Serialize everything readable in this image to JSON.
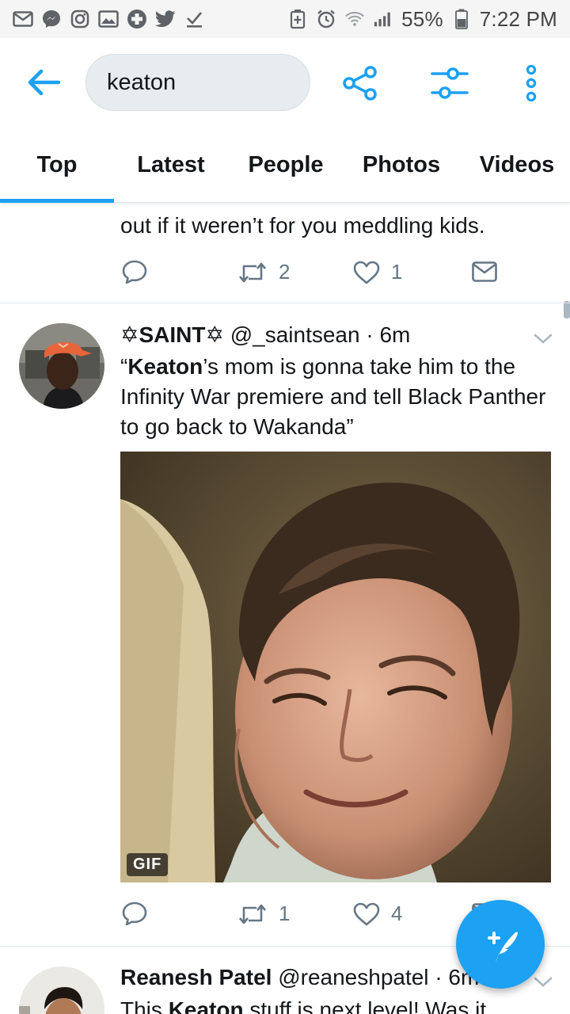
{
  "status_bar": {
    "left_icons": [
      "mail-icon",
      "messenger-icon",
      "instagram-icon",
      "gallery-icon",
      "medical-cross-icon",
      "twitter-bird-icon",
      "download-done-icon"
    ],
    "battery_percent": "55%",
    "time": "7:22 PM"
  },
  "search": {
    "query": "keaton"
  },
  "tabs": [
    {
      "label": "Top",
      "active": true
    },
    {
      "label": "Latest",
      "active": false
    },
    {
      "label": "People",
      "active": false
    },
    {
      "label": "Photos",
      "active": false
    },
    {
      "label": "Videos",
      "active": false
    }
  ],
  "tweets": [
    {
      "text_partial": "out if it weren’t for you meddling kids.",
      "retweets": "2",
      "likes": "1"
    },
    {
      "display_name": "✡SAINT✡",
      "handle": "@_saintsean",
      "time": "· 6m",
      "text_keyword": "Keaton",
      "text_open_quote": "“",
      "text_rest": "’s mom is gonna take him to the Infinity War premiere and tell Black Panther to go back to Wakanda”",
      "media_badge": "GIF",
      "replies": "",
      "retweets": "1",
      "likes": "4"
    },
    {
      "display_name": "Reanesh Patel",
      "handle": "@reaneshpatel",
      "time": "· 6m",
      "text_before": "This ",
      "text_keyword": "Keaton",
      "text_after": " stuff is next level! Was it"
    }
  ],
  "colors": {
    "accent": "#1da1f2",
    "text_primary": "#14171a",
    "text_secondary": "#657786",
    "divider": "#e1e8ed"
  }
}
